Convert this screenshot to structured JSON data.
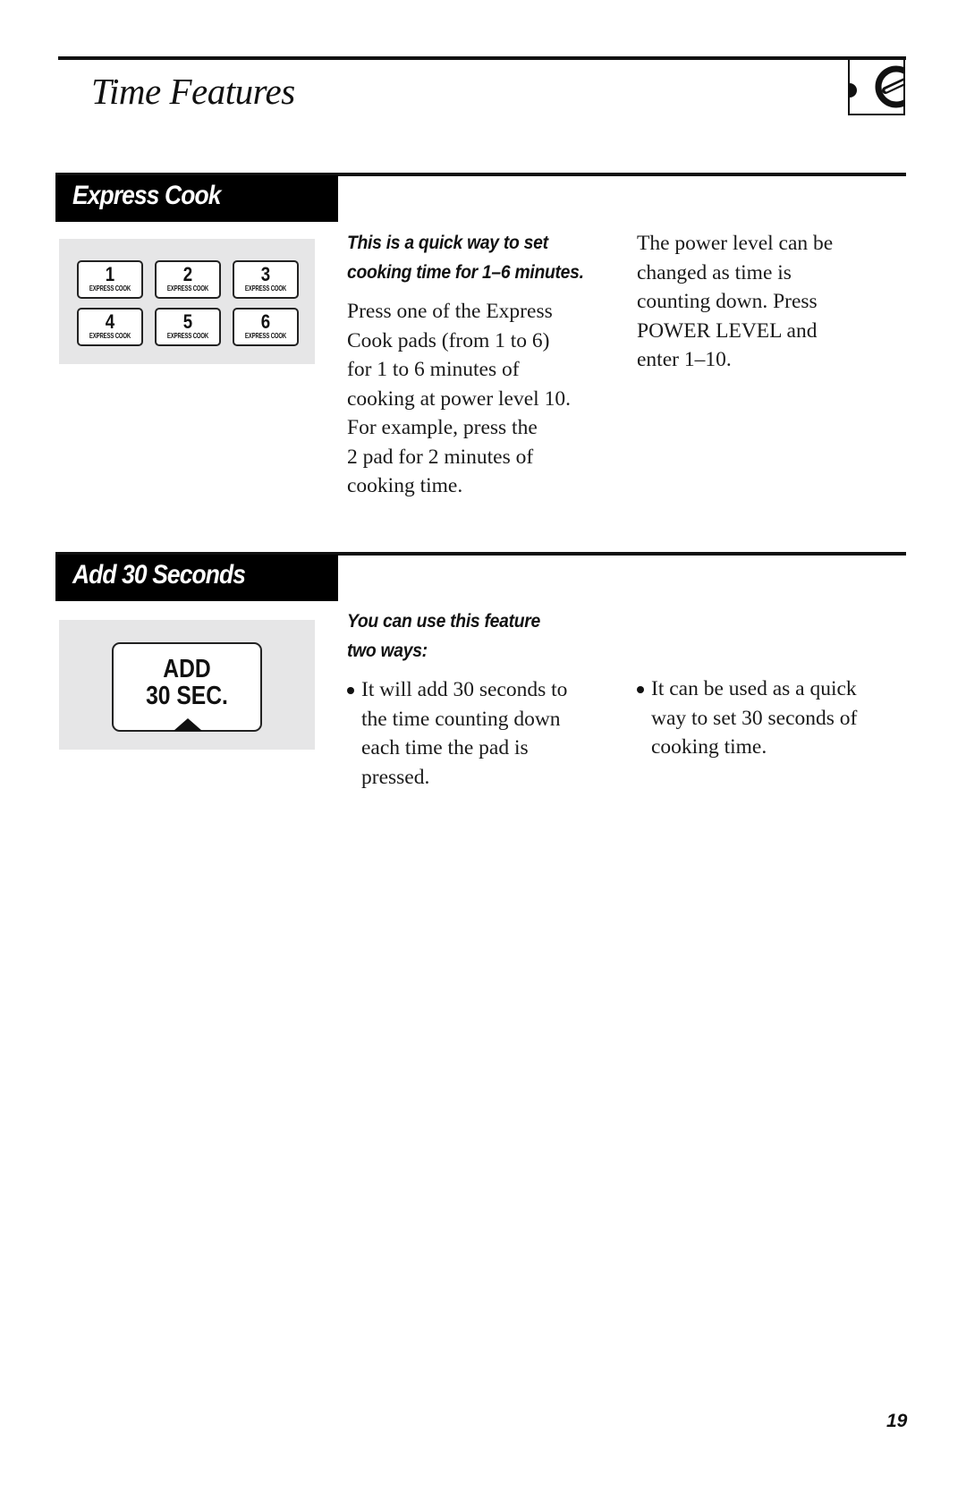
{
  "header": {
    "title": "Time Features",
    "icon": "timer-dial-icon"
  },
  "sections": [
    {
      "title": "Express Cook",
      "illustration": {
        "pads": [
          {
            "number": "1",
            "label": "EXPRESS COOK"
          },
          {
            "number": "2",
            "label": "EXPRESS COOK"
          },
          {
            "number": "3",
            "label": "EXPRESS COOK"
          },
          {
            "number": "4",
            "label": "EXPRESS COOK"
          },
          {
            "number": "5",
            "label": "EXPRESS COOK"
          },
          {
            "number": "6",
            "label": "EXPRESS COOK"
          }
        ]
      },
      "lead_lines": [
        "This is a quick way to set",
        "cooking time for 1–6 minutes."
      ],
      "body_lines": [
        "Press one of the Express",
        "Cook pads (from 1 to 6)",
        "for 1 to 6 minutes of",
        "cooking at power level 10.",
        "For example, press the",
        "2 pad for 2 minutes of",
        "cooking time."
      ],
      "side_lines": [
        "The power level can be",
        "changed as time is",
        "counting down. Press",
        "POWER LEVEL and",
        "enter 1–10."
      ]
    },
    {
      "title": "Add 30 Seconds",
      "illustration": {
        "pad_lines": [
          "ADD",
          "30 SEC."
        ]
      },
      "lead_lines": [
        "You can use this feature",
        "two ways:"
      ],
      "bullets": [
        {
          "lines": [
            "It will add 30 seconds to",
            "the time counting down",
            "each time the pad is",
            "pressed."
          ]
        },
        {
          "lines": [
            "It can be used as a quick",
            "way to set 30 seconds of",
            "cooking time."
          ]
        }
      ]
    }
  ],
  "footer": {
    "page_number": "19"
  }
}
